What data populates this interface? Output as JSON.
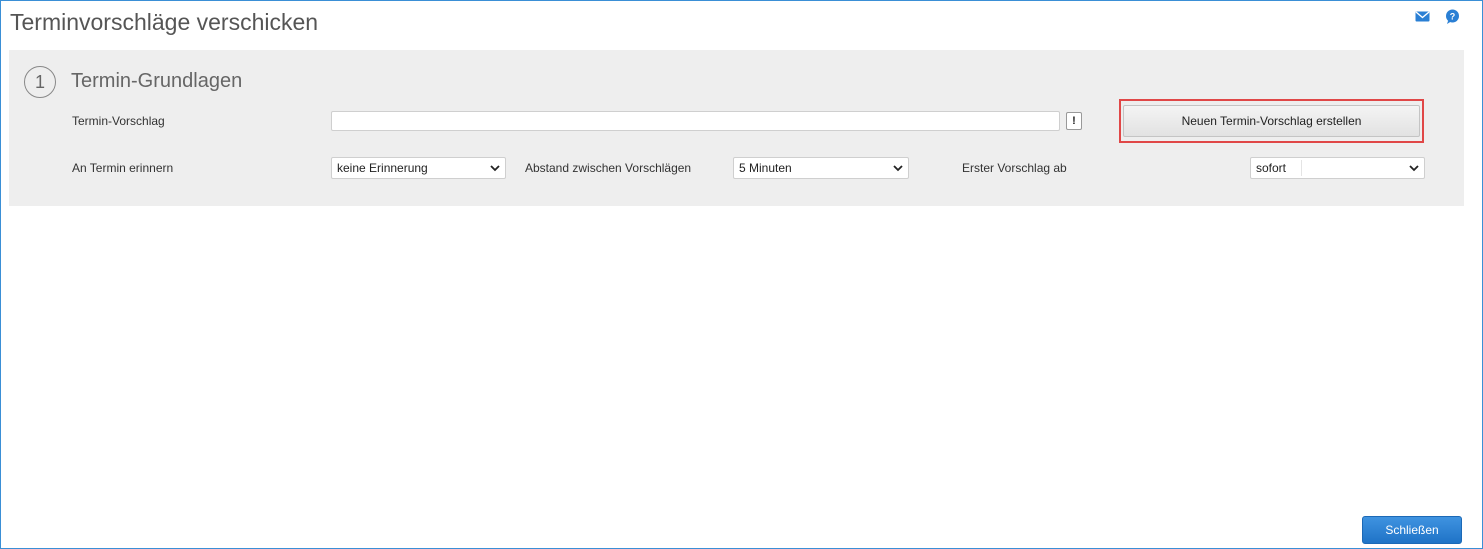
{
  "header": {
    "title": "Terminvorschläge verschicken",
    "icons": [
      "mail-icon",
      "help-icon"
    ]
  },
  "section": {
    "step_number": "1",
    "title": "Termin-Grundlagen",
    "termin_vorschlag": {
      "label": "Termin-Vorschlag",
      "value": "",
      "hint_button": "!"
    },
    "create_button": "Neuen Termin-Vorschlag erstellen",
    "reminder": {
      "label": "An Termin erinnern",
      "selected": "keine Erinnerung"
    },
    "interval": {
      "label": "Abstand zwischen Vorschlägen",
      "selected": "5 Minuten"
    },
    "first": {
      "label": "Erster Vorschlag ab",
      "selected": "sofort"
    }
  },
  "footer": {
    "close_button": "Schließen"
  },
  "colors": {
    "accent": "#2a7fd4",
    "highlight": "#e04747",
    "section_bg": "#eeeeee"
  }
}
